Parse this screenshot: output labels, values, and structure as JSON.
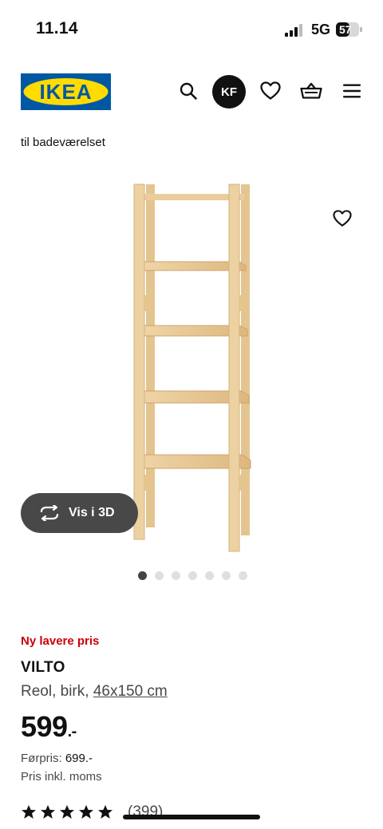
{
  "status_bar": {
    "time": "11.14",
    "network": "5G",
    "battery": "57"
  },
  "header": {
    "logo_text": "IKEA",
    "avatar_initials": "KF"
  },
  "breadcrumb": "til badeværelset",
  "carousel": {
    "view3d_label": "Vis i 3D",
    "dot_count": 7,
    "active_index": 0
  },
  "product": {
    "badge": "Ny lavere pris",
    "name": "VILTO",
    "desc_text": "Reol, birk, ",
    "dimensions": "46x150 cm",
    "price": "599",
    "price_suffix": ".-",
    "prev_price_label": "Førpris: ",
    "prev_price_value": "699.-",
    "vat_note": "Pris inkl. moms",
    "rating_stars": 5,
    "review_count": "(399)"
  },
  "colors": {
    "brand_blue": "#0058A3",
    "brand_yellow": "#FFDB00",
    "sale_red": "#CC0008",
    "wood": "#E8C893"
  }
}
